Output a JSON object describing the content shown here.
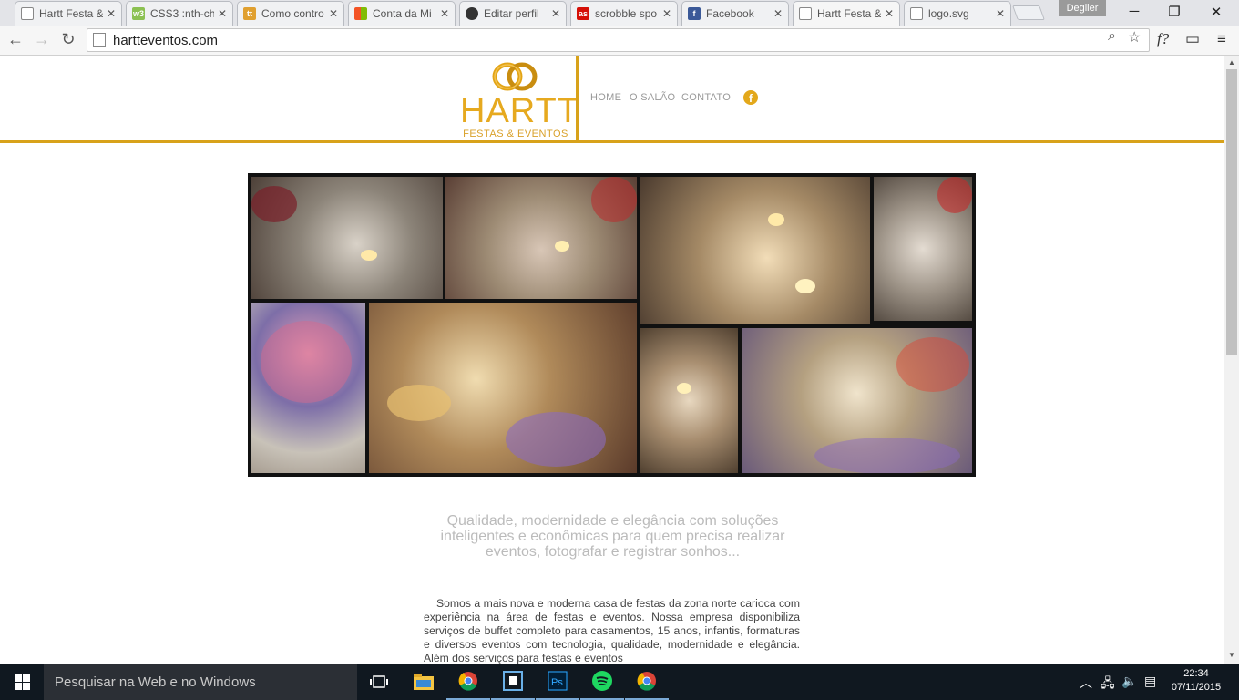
{
  "browser": {
    "tabs": [
      {
        "title": "Hartt Festa &",
        "favicon": "page-icon",
        "fav_color": "#888888"
      },
      {
        "title": "CSS3 :nth-ch",
        "favicon": "w3-icon",
        "fav_color": "#8cc152"
      },
      {
        "title": "Como contro",
        "favicon": "tt-icon",
        "fav_color": "#e0a030"
      },
      {
        "title": "Conta da Mi",
        "favicon": "microsoft-icon",
        "fav_color": "#f35325"
      },
      {
        "title": "Editar perfil",
        "favicon": "spotify-icon",
        "fav_color": "#333333"
      },
      {
        "title": "scrobble spo",
        "favicon": "lastfm-icon",
        "fav_color": "#d51007"
      },
      {
        "title": "Facebook",
        "favicon": "facebook-icon",
        "fav_color": "#3b5998"
      },
      {
        "title": "Hartt Festa &",
        "favicon": "page-icon",
        "fav_color": "#888888"
      },
      {
        "title": "logo.svg",
        "favicon": "page-icon",
        "fav_color": "#888888"
      }
    ],
    "profile_name": "Deglier",
    "url": "hartteventos.com",
    "extension_label": "f?"
  },
  "site": {
    "brand": "HARTT",
    "brand_sub": "FESTAS & EVENTOS",
    "menu": [
      "HOME",
      "O SALÃO",
      "CONTATO"
    ],
    "facebook_glyph": "f",
    "tagline": "Qualidade, modernidade e elegância com soluções inteligentes e econômicas para quem precisa realizar eventos, fotografar e registrar sonhos...",
    "about": "Somos a mais nova e moderna casa de festas da zona norte carioca com experiência na área de festas e eventos. Nossa empresa disponibiliza serviços de buffet completo para casamentos, 15 anos, infantis, formaturas e diversos eventos com tecnologia, qualidade, modernidade e elegância. Além dos serviços para festas e eventos",
    "accent": "#d8a21a"
  },
  "taskbar": {
    "search_placeholder": "Pesquisar na Web e no Windows",
    "time": "22:34",
    "date": "07/11/2015"
  }
}
